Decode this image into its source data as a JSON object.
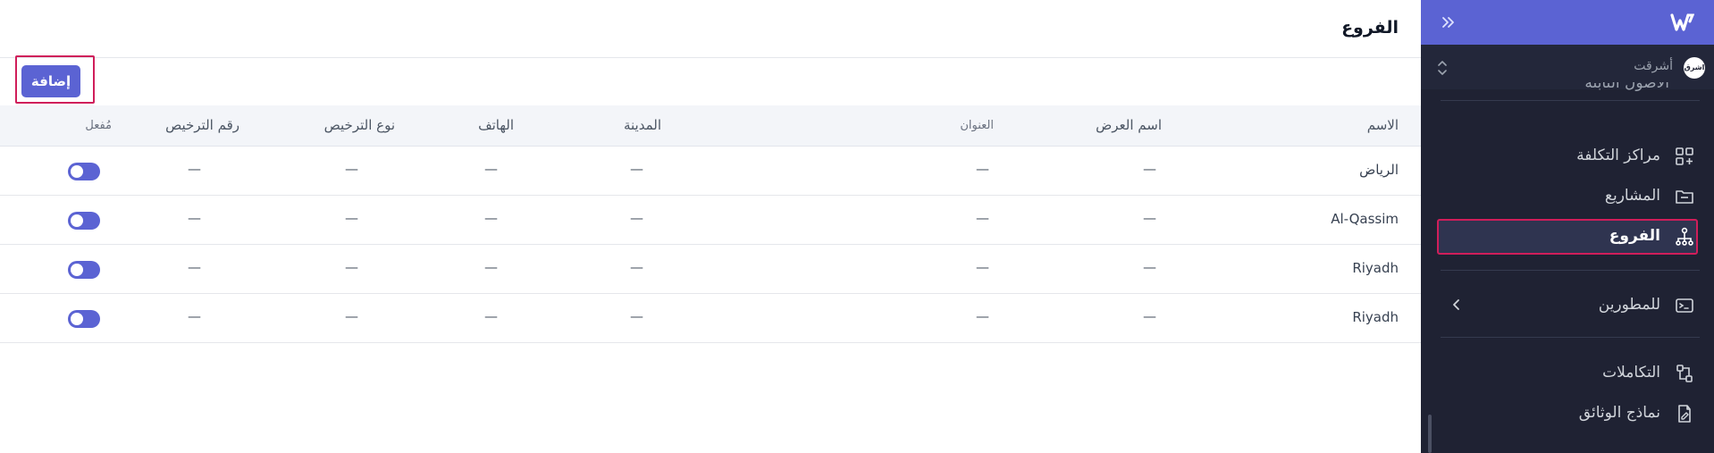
{
  "page": {
    "title": "الفروع",
    "add_label": "إضافة"
  },
  "table": {
    "headers": {
      "name": "الاسم",
      "display_name": "اسم العرض",
      "address": "العنوان",
      "city": "المدينة",
      "phone": "الهاتف",
      "license_type": "نوع الترخيص",
      "license_number": "رقم الترخيص",
      "enabled": "مُفعل"
    },
    "rows": [
      {
        "name": "الرياض",
        "display_name": "—",
        "address": "—",
        "city": "—",
        "phone": "—",
        "license_type": "—",
        "license_number": "—",
        "enabled": true
      },
      {
        "name": "Al-Qassim",
        "display_name": "—",
        "address": "—",
        "city": "—",
        "phone": "—",
        "license_type": "—",
        "license_number": "—",
        "enabled": true
      },
      {
        "name": "Riyadh",
        "display_name": "—",
        "address": "—",
        "city": "—",
        "phone": "—",
        "license_type": "—",
        "license_number": "—",
        "enabled": true
      },
      {
        "name": "Riyadh",
        "display_name": "—",
        "address": "—",
        "city": "—",
        "phone": "—",
        "license_type": "—",
        "license_number": "—",
        "enabled": true
      }
    ]
  },
  "sidebar": {
    "company": {
      "name": "أشرقت",
      "avatar_text": "اشرق"
    },
    "partial_item": "الأصول الثابتة",
    "items": [
      {
        "label": "مراكز التكلفة",
        "icon": "grid-plus-icon"
      },
      {
        "label": "المشاريع",
        "icon": "folder-icon"
      },
      {
        "label": "الفروع",
        "icon": "branches-icon",
        "active": true
      },
      {
        "label": "للمطورين",
        "icon": "terminal-icon"
      },
      {
        "label": "التكاملات",
        "icon": "integrations-icon"
      },
      {
        "label": "نماذج الوثائق",
        "icon": "document-edit-icon"
      }
    ]
  },
  "colors": {
    "accent": "#5b63d3",
    "sidebar_bg": "#1f2233",
    "highlight": "#d01e5a"
  }
}
